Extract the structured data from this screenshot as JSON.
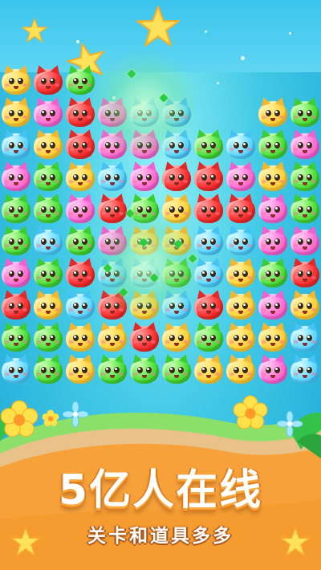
{
  "banner": {
    "headline": "5亿人在线",
    "subtitle": "关卡和道具多多"
  },
  "board": {
    "rows": [
      [
        "yellow",
        "red",
        "green",
        "",
        "",
        "",
        "",
        "",
        "",
        ""
      ],
      [
        "yellow",
        "pink",
        "red",
        "pink",
        "blue",
        "blue",
        "",
        "",
        "yellow",
        "green"
      ],
      [
        "blue",
        "yellow",
        "red",
        "pink",
        "pink",
        "blue",
        "green",
        "blue",
        "green",
        "pink"
      ],
      [
        "pink",
        "green",
        "yellow",
        "blue",
        "pink",
        "red",
        "red",
        "pink",
        "yellow",
        "green"
      ],
      [
        "green",
        "green",
        "pink",
        "red",
        "green",
        "yellow",
        "red",
        "red",
        "pink",
        "green"
      ],
      [
        "green",
        "blue",
        "green",
        "pink",
        "yellow",
        "yellow",
        "blue",
        "blue",
        "pink",
        "pink"
      ],
      [
        "pink",
        "green",
        "red",
        "blue",
        "blue",
        "green",
        "blue",
        "yellow",
        "green",
        "red"
      ],
      [
        "red",
        "yellow",
        "blue",
        "red",
        "yellow",
        "blue",
        "red",
        "yellow",
        "pink",
        "yellow"
      ],
      [
        "green",
        "green",
        "yellow",
        "yellow",
        "red",
        "yellow",
        "green",
        "yellow",
        "yellow",
        "blue"
      ],
      [
        "blue",
        "green",
        "yellow",
        "green",
        "green",
        "green",
        "yellow",
        "yellow",
        "pink",
        "blue"
      ]
    ]
  },
  "colors": {
    "yellow": "#ffd23a",
    "pink": "#ff6fd6",
    "red": "#ff3131",
    "blue": "#5fd8ff",
    "green": "#4fe03b",
    "headline_outline": "#e07a1d",
    "sand": "#f7a13a",
    "grass": "#35c24a"
  },
  "icons": {
    "stars": "star-icon",
    "flowers": "flower-icon",
    "cats": "cat-candy-icon"
  }
}
